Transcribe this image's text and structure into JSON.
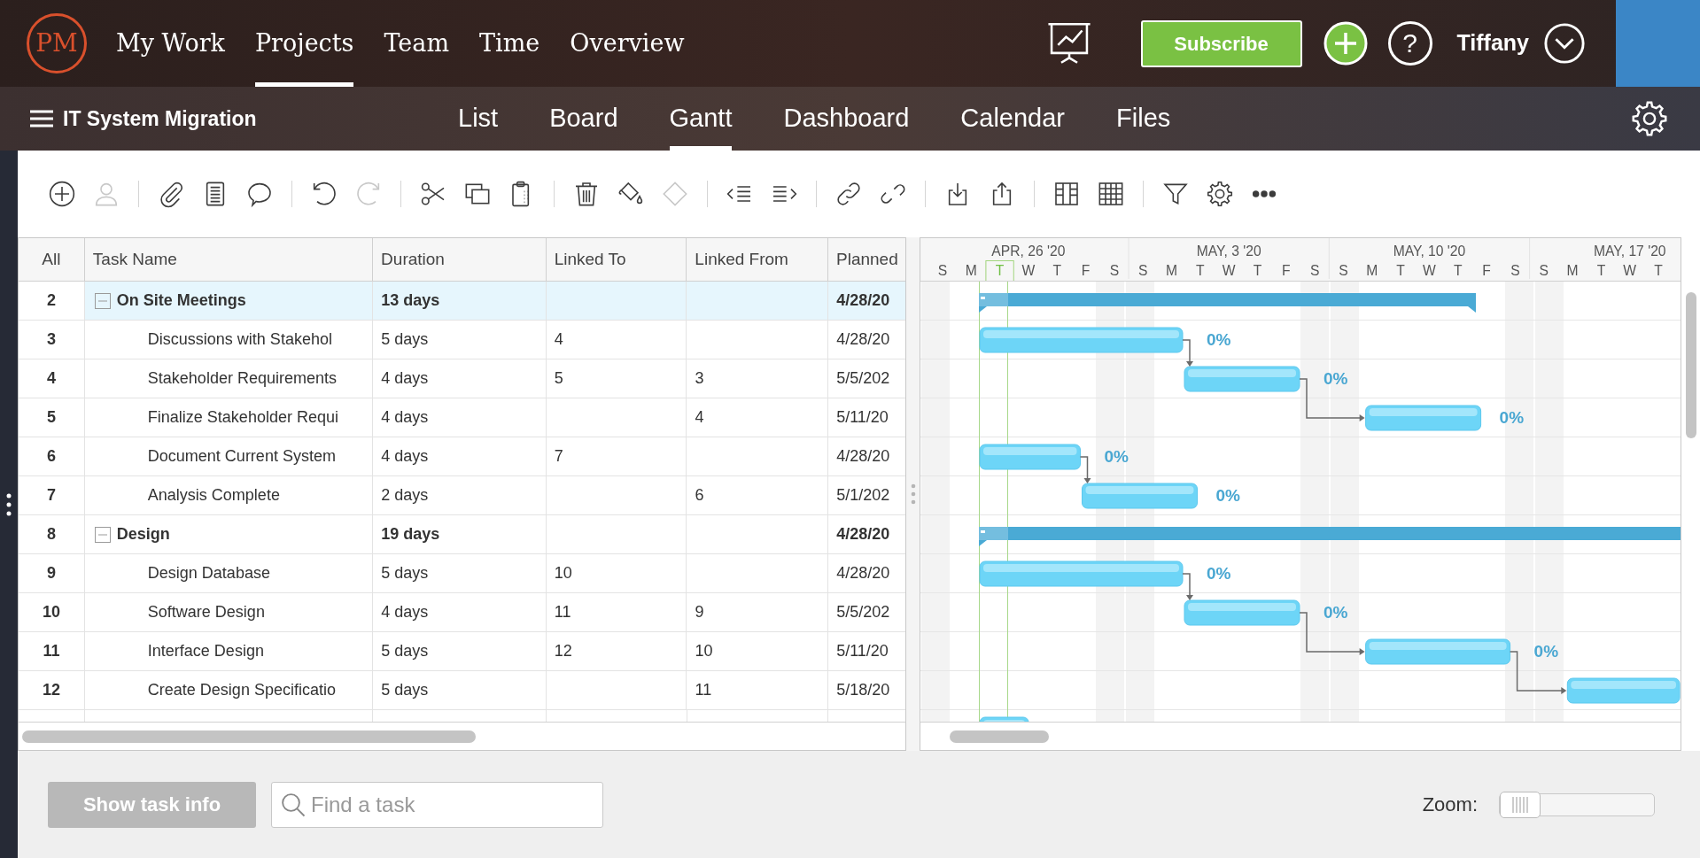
{
  "app": {
    "logo": "PM",
    "nav": [
      {
        "label": "My Work",
        "selected": false
      },
      {
        "label": "Projects",
        "selected": true
      },
      {
        "label": "Team",
        "selected": false
      },
      {
        "label": "Time",
        "selected": false
      },
      {
        "label": "Overview",
        "selected": false
      }
    ],
    "subscribe": "Subscribe",
    "help": "?",
    "user": "Tiffany"
  },
  "project": {
    "title": "IT System Migration",
    "views": [
      {
        "label": "List",
        "selected": false
      },
      {
        "label": "Board",
        "selected": false
      },
      {
        "label": "Gantt",
        "selected": true
      },
      {
        "label": "Dashboard",
        "selected": false
      },
      {
        "label": "Calendar",
        "selected": false
      },
      {
        "label": "Files",
        "selected": false
      }
    ]
  },
  "toolbar": {
    "groups": [
      [
        {
          "kind": "add",
          "disabled": false
        },
        {
          "kind": "assign",
          "disabled": true
        }
      ],
      [
        {
          "kind": "attach",
          "disabled": false
        },
        {
          "kind": "notes",
          "disabled": false
        },
        {
          "kind": "comment",
          "disabled": false
        }
      ],
      [
        {
          "kind": "undo",
          "disabled": false
        },
        {
          "kind": "redo",
          "disabled": true
        }
      ],
      [
        {
          "kind": "cut",
          "disabled": false
        },
        {
          "kind": "copy",
          "disabled": false
        },
        {
          "kind": "paste",
          "disabled": false
        }
      ],
      [
        {
          "kind": "delete",
          "disabled": false
        },
        {
          "kind": "fill",
          "disabled": false
        },
        {
          "kind": "milestone",
          "disabled": true
        }
      ],
      [
        {
          "kind": "outdent",
          "disabled": false
        },
        {
          "kind": "indent",
          "disabled": false
        }
      ],
      [
        {
          "kind": "link",
          "disabled": false
        },
        {
          "kind": "unlink",
          "disabled": false
        }
      ],
      [
        {
          "kind": "import",
          "disabled": false
        },
        {
          "kind": "export",
          "disabled": false
        }
      ],
      [
        {
          "kind": "columns",
          "disabled": false
        },
        {
          "kind": "grid",
          "disabled": false
        }
      ],
      [
        {
          "kind": "filter",
          "disabled": false
        },
        {
          "kind": "settings",
          "disabled": false
        },
        {
          "kind": "more",
          "disabled": false
        }
      ]
    ]
  },
  "table": {
    "columns": [
      "All",
      "Task Name",
      "Duration",
      "Linked To",
      "Linked From",
      "Planned"
    ],
    "rows": [
      {
        "id": "2",
        "name": "On Site Meetings",
        "duration": "13 days",
        "planned": "4/28/20",
        "selected": true,
        "expanded": true,
        "children": [
          {
            "id": "3",
            "name": "Discussions with Stakehol",
            "duration": "5 days",
            "linked_to": "4",
            "planned": "4/28/20",
            "progress": "0%",
            "selected": false
          },
          {
            "id": "4",
            "name": "Stakeholder Requirements",
            "duration": "4 days",
            "linked_to": "5",
            "linked_from": "3",
            "planned": "5/5/202",
            "progress": "0%",
            "selected": false
          },
          {
            "id": "5",
            "name": "Finalize Stakeholder Requi",
            "duration": "4 days",
            "linked_from": "4",
            "planned": "5/11/20",
            "progress": "0%",
            "selected": false
          },
          {
            "id": "6",
            "name": "Document Current System",
            "duration": "4 days",
            "linked_to": "7",
            "planned": "4/28/20",
            "progress": "0%",
            "selected": false
          },
          {
            "id": "7",
            "name": "Analysis Complete",
            "duration": "2 days",
            "linked_from": "6",
            "planned": "5/1/202",
            "progress": "0%",
            "selected": false
          }
        ]
      },
      {
        "id": "8",
        "name": "Design",
        "duration": "19 days",
        "planned": "4/28/20",
        "selected": false,
        "expanded": true,
        "children": [
          {
            "id": "9",
            "name": "Design Database",
            "duration": "5 days",
            "linked_to": "10",
            "planned": "4/28/20",
            "progress": "0%",
            "selected": false
          },
          {
            "id": "10",
            "name": "Software Design",
            "duration": "4 days",
            "linked_to": "11",
            "linked_from": "9",
            "planned": "5/5/202",
            "progress": "0%",
            "selected": false
          },
          {
            "id": "11",
            "name": "Interface Design",
            "duration": "5 days",
            "linked_to": "12",
            "linked_from": "10",
            "planned": "5/11/20",
            "progress": "0%",
            "selected": false
          },
          {
            "id": "12",
            "name": "Create Design Specificatio",
            "duration": "5 days",
            "linked_from": "11",
            "planned": "5/18/20",
            "selected": false
          }
        ]
      }
    ]
  },
  "gantt": {
    "weeks": [
      "APR, 26 '20",
      "MAY, 3 '20",
      "MAY, 10 '20",
      "MAY, 17 '20"
    ],
    "days": [
      {
        "letter": "S",
        "today": false
      },
      {
        "letter": "M",
        "today": false
      },
      {
        "letter": "T",
        "today": true
      },
      {
        "letter": "W",
        "today": false
      },
      {
        "letter": "T",
        "today": false
      },
      {
        "letter": "F",
        "today": false
      },
      {
        "letter": "S",
        "today": false
      },
      {
        "letter": "S",
        "today": false
      },
      {
        "letter": "M",
        "today": false
      },
      {
        "letter": "T",
        "today": false
      },
      {
        "letter": "W",
        "today": false
      },
      {
        "letter": "T",
        "today": false
      },
      {
        "letter": "F",
        "today": false
      },
      {
        "letter": "S",
        "today": false
      },
      {
        "letter": "S",
        "today": false
      },
      {
        "letter": "M",
        "today": false
      },
      {
        "letter": "T",
        "today": false
      },
      {
        "letter": "W",
        "today": false
      },
      {
        "letter": "T",
        "today": false
      },
      {
        "letter": "F",
        "today": false
      },
      {
        "letter": "S",
        "today": false
      },
      {
        "letter": "S",
        "today": false
      },
      {
        "letter": "M",
        "today": false
      },
      {
        "letter": "T",
        "today": false
      },
      {
        "letter": "W",
        "today": false
      },
      {
        "letter": "T",
        "today": false
      }
    ]
  },
  "footer": {
    "show_task_info": {
      "label": "Show task info",
      "disabled": true
    },
    "search": {
      "placeholder": "Find a task"
    },
    "zoom": {
      "label": "Zoom:",
      "level": 0
    }
  }
}
